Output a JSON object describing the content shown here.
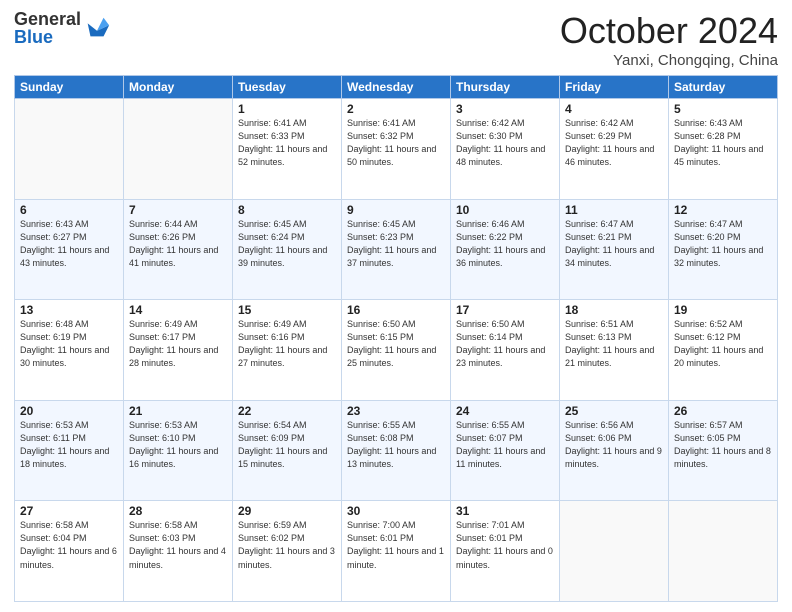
{
  "header": {
    "logo_general": "General",
    "logo_blue": "Blue",
    "month_title": "October 2024",
    "location": "Yanxi, Chongqing, China"
  },
  "days_of_week": [
    "Sunday",
    "Monday",
    "Tuesday",
    "Wednesday",
    "Thursday",
    "Friday",
    "Saturday"
  ],
  "weeks": [
    [
      {
        "day": "",
        "info": ""
      },
      {
        "day": "",
        "info": ""
      },
      {
        "day": "1",
        "info": "Sunrise: 6:41 AM\nSunset: 6:33 PM\nDaylight: 11 hours and 52 minutes."
      },
      {
        "day": "2",
        "info": "Sunrise: 6:41 AM\nSunset: 6:32 PM\nDaylight: 11 hours and 50 minutes."
      },
      {
        "day": "3",
        "info": "Sunrise: 6:42 AM\nSunset: 6:30 PM\nDaylight: 11 hours and 48 minutes."
      },
      {
        "day": "4",
        "info": "Sunrise: 6:42 AM\nSunset: 6:29 PM\nDaylight: 11 hours and 46 minutes."
      },
      {
        "day": "5",
        "info": "Sunrise: 6:43 AM\nSunset: 6:28 PM\nDaylight: 11 hours and 45 minutes."
      }
    ],
    [
      {
        "day": "6",
        "info": "Sunrise: 6:43 AM\nSunset: 6:27 PM\nDaylight: 11 hours and 43 minutes."
      },
      {
        "day": "7",
        "info": "Sunrise: 6:44 AM\nSunset: 6:26 PM\nDaylight: 11 hours and 41 minutes."
      },
      {
        "day": "8",
        "info": "Sunrise: 6:45 AM\nSunset: 6:24 PM\nDaylight: 11 hours and 39 minutes."
      },
      {
        "day": "9",
        "info": "Sunrise: 6:45 AM\nSunset: 6:23 PM\nDaylight: 11 hours and 37 minutes."
      },
      {
        "day": "10",
        "info": "Sunrise: 6:46 AM\nSunset: 6:22 PM\nDaylight: 11 hours and 36 minutes."
      },
      {
        "day": "11",
        "info": "Sunrise: 6:47 AM\nSunset: 6:21 PM\nDaylight: 11 hours and 34 minutes."
      },
      {
        "day": "12",
        "info": "Sunrise: 6:47 AM\nSunset: 6:20 PM\nDaylight: 11 hours and 32 minutes."
      }
    ],
    [
      {
        "day": "13",
        "info": "Sunrise: 6:48 AM\nSunset: 6:19 PM\nDaylight: 11 hours and 30 minutes."
      },
      {
        "day": "14",
        "info": "Sunrise: 6:49 AM\nSunset: 6:17 PM\nDaylight: 11 hours and 28 minutes."
      },
      {
        "day": "15",
        "info": "Sunrise: 6:49 AM\nSunset: 6:16 PM\nDaylight: 11 hours and 27 minutes."
      },
      {
        "day": "16",
        "info": "Sunrise: 6:50 AM\nSunset: 6:15 PM\nDaylight: 11 hours and 25 minutes."
      },
      {
        "day": "17",
        "info": "Sunrise: 6:50 AM\nSunset: 6:14 PM\nDaylight: 11 hours and 23 minutes."
      },
      {
        "day": "18",
        "info": "Sunrise: 6:51 AM\nSunset: 6:13 PM\nDaylight: 11 hours and 21 minutes."
      },
      {
        "day": "19",
        "info": "Sunrise: 6:52 AM\nSunset: 6:12 PM\nDaylight: 11 hours and 20 minutes."
      }
    ],
    [
      {
        "day": "20",
        "info": "Sunrise: 6:53 AM\nSunset: 6:11 PM\nDaylight: 11 hours and 18 minutes."
      },
      {
        "day": "21",
        "info": "Sunrise: 6:53 AM\nSunset: 6:10 PM\nDaylight: 11 hours and 16 minutes."
      },
      {
        "day": "22",
        "info": "Sunrise: 6:54 AM\nSunset: 6:09 PM\nDaylight: 11 hours and 15 minutes."
      },
      {
        "day": "23",
        "info": "Sunrise: 6:55 AM\nSunset: 6:08 PM\nDaylight: 11 hours and 13 minutes."
      },
      {
        "day": "24",
        "info": "Sunrise: 6:55 AM\nSunset: 6:07 PM\nDaylight: 11 hours and 11 minutes."
      },
      {
        "day": "25",
        "info": "Sunrise: 6:56 AM\nSunset: 6:06 PM\nDaylight: 11 hours and 9 minutes."
      },
      {
        "day": "26",
        "info": "Sunrise: 6:57 AM\nSunset: 6:05 PM\nDaylight: 11 hours and 8 minutes."
      }
    ],
    [
      {
        "day": "27",
        "info": "Sunrise: 6:58 AM\nSunset: 6:04 PM\nDaylight: 11 hours and 6 minutes."
      },
      {
        "day": "28",
        "info": "Sunrise: 6:58 AM\nSunset: 6:03 PM\nDaylight: 11 hours and 4 minutes."
      },
      {
        "day": "29",
        "info": "Sunrise: 6:59 AM\nSunset: 6:02 PM\nDaylight: 11 hours and 3 minutes."
      },
      {
        "day": "30",
        "info": "Sunrise: 7:00 AM\nSunset: 6:01 PM\nDaylight: 11 hours and 1 minute."
      },
      {
        "day": "31",
        "info": "Sunrise: 7:01 AM\nSunset: 6:01 PM\nDaylight: 11 hours and 0 minutes."
      },
      {
        "day": "",
        "info": ""
      },
      {
        "day": "",
        "info": ""
      }
    ]
  ]
}
